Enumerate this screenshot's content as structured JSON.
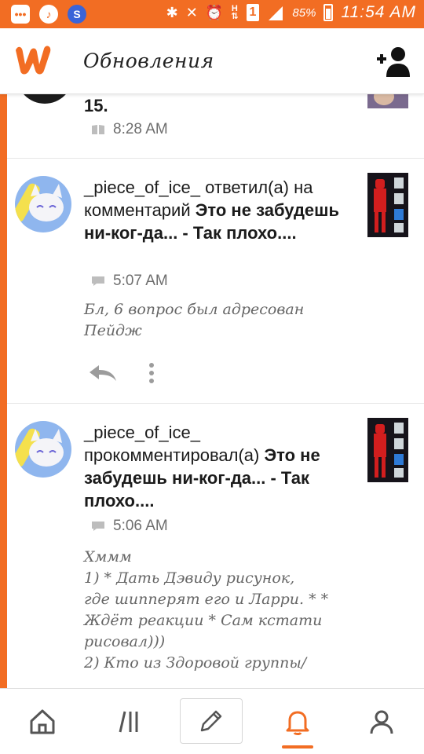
{
  "status_bar": {
    "h_label": "H",
    "badge": "1",
    "battery": "85%",
    "time": "11:54 AM"
  },
  "header": {
    "title": "Обновления"
  },
  "feed": {
    "items": [
      {
        "text_tail": "15.",
        "time": "8:28 AM",
        "meta_icon": "book-icon"
      },
      {
        "user": "_piece_of_ice_",
        "action": "ответил(а) на комментарий",
        "story": "Это не забудешь ни-ког-да... - Так плохо....",
        "time": "5:07 AM",
        "meta_icon": "comment-icon",
        "comment": "Бл, 6 вопрос был адресован Пейдж"
      },
      {
        "user": "_piece_of_ice_",
        "action": "прокомментировал(а)",
        "story": "Это не забудешь ни-ког-да... - Так плохо....",
        "time": "5:06 AM",
        "meta_icon": "comment-icon",
        "comment_lines": [
          "Хммм",
          "1) * Дать Дэвиду рисунок,",
          "где шипперят его и Ларри. * *",
          "Ждёт реакции * Сам кстати",
          "рисовал)))",
          "2) Кто из Здоровой группы/"
        ]
      }
    ]
  },
  "bottom_nav": {
    "items": [
      "home-icon",
      "library-icon",
      "write-icon",
      "notifications-icon",
      "profile-icon"
    ],
    "active": "notifications-icon"
  },
  "colors": {
    "accent": "#f26d23",
    "avatar_bg": "#8fb6ee"
  }
}
